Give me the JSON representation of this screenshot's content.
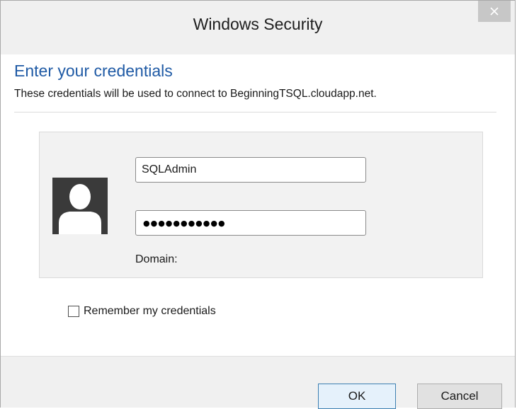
{
  "window": {
    "title": "Windows Security",
    "close_icon": "close-icon"
  },
  "prompt": {
    "heading": "Enter your credentials",
    "subheading": "These credentials will be used to connect to BeginningTSQL.cloudapp.net."
  },
  "credentials": {
    "avatar_icon": "user-avatar-icon",
    "username_value": "SQLAdmin",
    "password_masked": "●●●●●●●●●●●",
    "domain_label": "Domain:"
  },
  "remember": {
    "label": "Remember my credentials",
    "checked": false
  },
  "buttons": {
    "ok_label": "OK",
    "cancel_label": "Cancel"
  },
  "colors": {
    "heading_blue": "#1f5aa5",
    "ok_border": "#3c7fb1",
    "close_button_bg": "#c7c7c7"
  }
}
